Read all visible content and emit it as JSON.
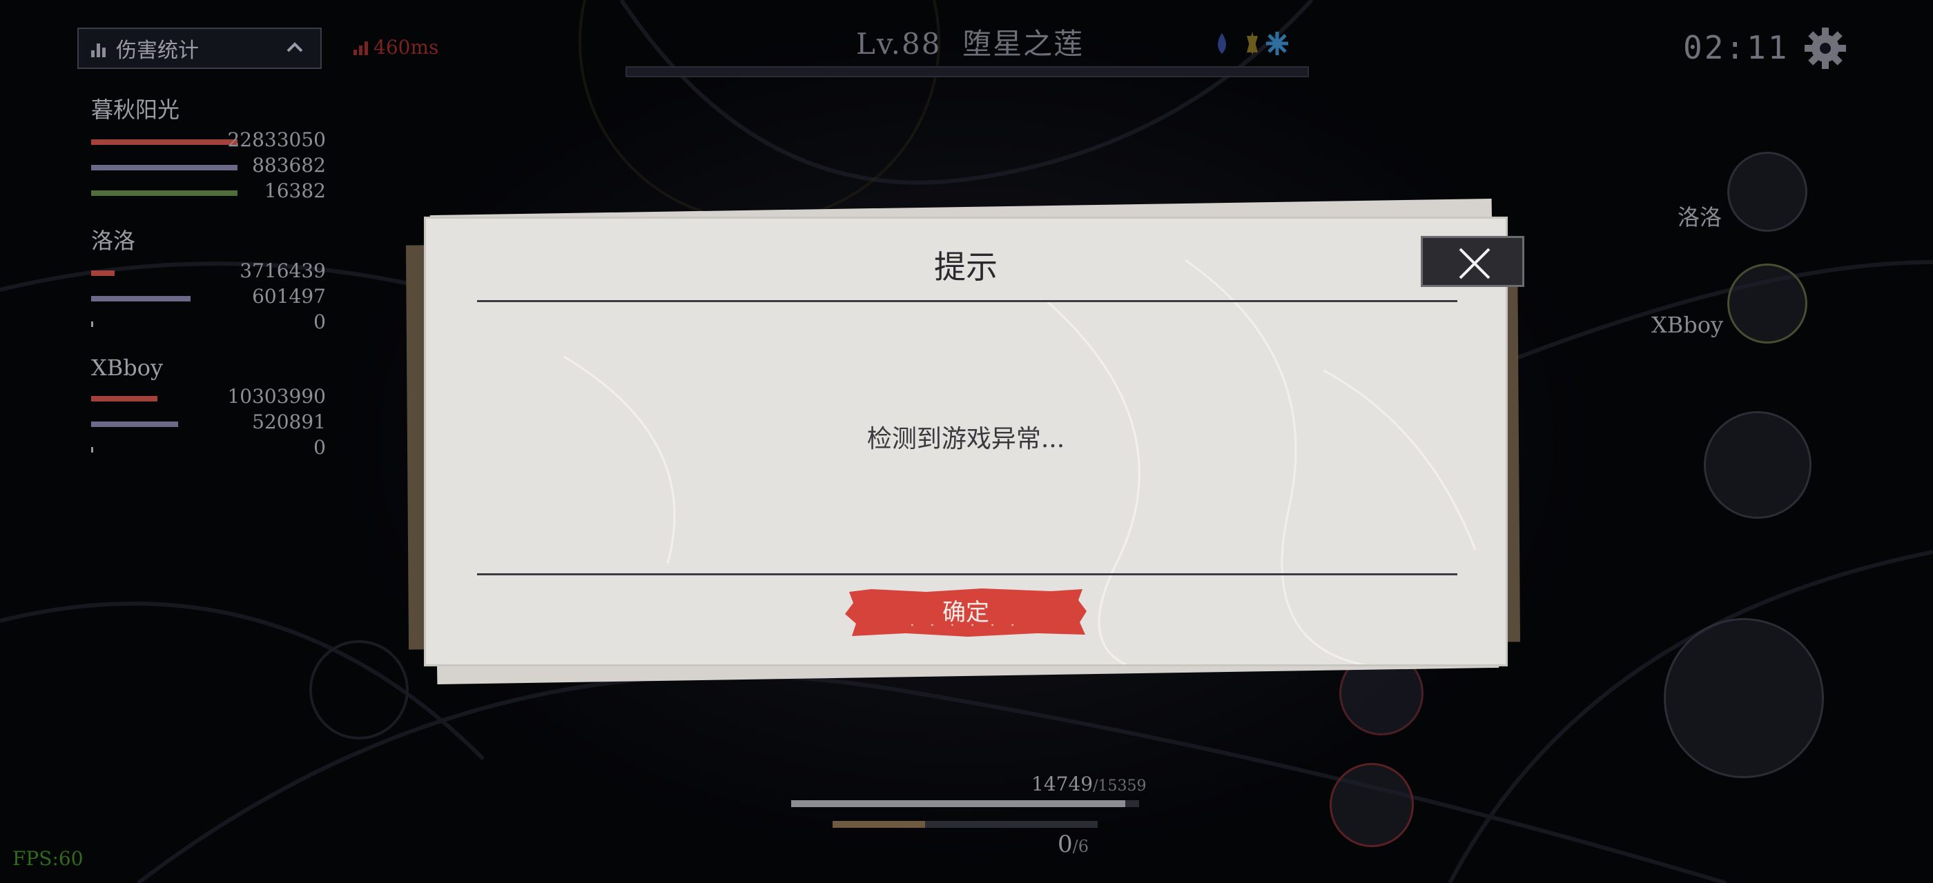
{
  "hud": {
    "damage_title": "伤害统计",
    "ping": "460ms",
    "level": "Lv.88",
    "boss_name": "堕星之莲",
    "timer": "02:11",
    "fps": "FPS:60",
    "hp_current": "14749",
    "hp_max": "/15359",
    "hp_fraction": 0.96,
    "energy_fraction": 0.35,
    "charge_current": "0",
    "charge_max": "/6"
  },
  "damage_stats": [
    {
      "name": "暮秋阳光",
      "values": [
        "22833050",
        "883682",
        "16382"
      ],
      "fractions": [
        1.0,
        1.0,
        1.0
      ]
    },
    {
      "name": "洛洛",
      "values": [
        "3716439",
        "601497",
        "0"
      ],
      "fractions": [
        0.17,
        0.68,
        0.01
      ]
    },
    {
      "name": "XBboy",
      "values": [
        "10303990",
        "520891",
        "0"
      ],
      "fractions": [
        0.45,
        0.59,
        0.01
      ]
    }
  ],
  "party": {
    "member1": "洛洛",
    "member2": "XBboy"
  },
  "dialog": {
    "title": "提示",
    "message": "检测到游戏异常...",
    "confirm_label": "确定",
    "confirm_sub": "• • • • • •"
  },
  "colors": {
    "confirm_red": "#d5433a",
    "paper": "#e4e2df",
    "damage_red": "#a4413a",
    "damage_purple": "#6b6a8a",
    "damage_green": "#4f6e3c"
  }
}
